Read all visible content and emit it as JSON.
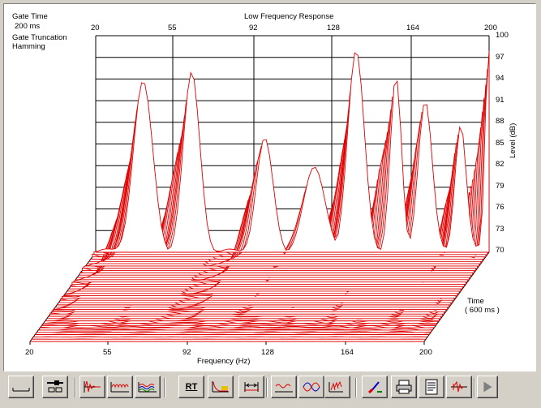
{
  "title": "Low Frequency Response",
  "gate_time_label": "Gate Time",
  "gate_time_value": "200 ms",
  "gate_truncation_label": "Gate Truncation",
  "gate_truncation_value": "Hamming",
  "level_axis_label": "Level (dB)",
  "time_axis_label": "Time",
  "time_axis_value": "( 600 ms )",
  "frequency_axis_label": "Frequency (Hz)",
  "top_freq_ticks": [
    "20",
    "55",
    "92",
    "128",
    "164",
    "200"
  ],
  "bottom_freq_ticks": [
    "20",
    "55",
    "92",
    "128",
    "164",
    "200"
  ],
  "level_ticks": [
    "100",
    "97",
    "94",
    "91",
    "88",
    "85",
    "82",
    "79",
    "76",
    "73",
    "70"
  ],
  "colors": {
    "trace": "#e00000",
    "background": "#ffffff",
    "grid": "#000000",
    "toolbar": "#d4d0c8"
  },
  "toolbar": {
    "buttons": [
      {
        "name": "baseline-button",
        "icon": "baseline-icon"
      },
      {
        "name": "slider-settings-button",
        "icon": "slider-icon"
      },
      {
        "name": "impulse-button",
        "icon": "impulse-icon"
      },
      {
        "name": "frequency-response-button",
        "icon": "frequency-response-icon"
      },
      {
        "name": "multi-response-button",
        "icon": "multi-response-icon"
      },
      {
        "name": "rt-button",
        "label": "RT"
      },
      {
        "name": "decay-button",
        "icon": "decay-icon"
      },
      {
        "name": "gate-marker-button",
        "icon": "gate-marker-icon"
      },
      {
        "name": "response-curve-button",
        "icon": "response-curve-icon"
      },
      {
        "name": "sine-wave-button",
        "icon": "sine-wave-icon"
      },
      {
        "name": "waterfall-button",
        "icon": "waterfall-icon"
      },
      {
        "name": "color-palette-button",
        "icon": "palette-icon"
      },
      {
        "name": "print-button",
        "icon": "printer-icon"
      },
      {
        "name": "report-button",
        "icon": "document-icon"
      },
      {
        "name": "speaker-button",
        "icon": "speaker-icon"
      },
      {
        "name": "next-button",
        "icon": "play-arrow-icon"
      }
    ]
  }
}
